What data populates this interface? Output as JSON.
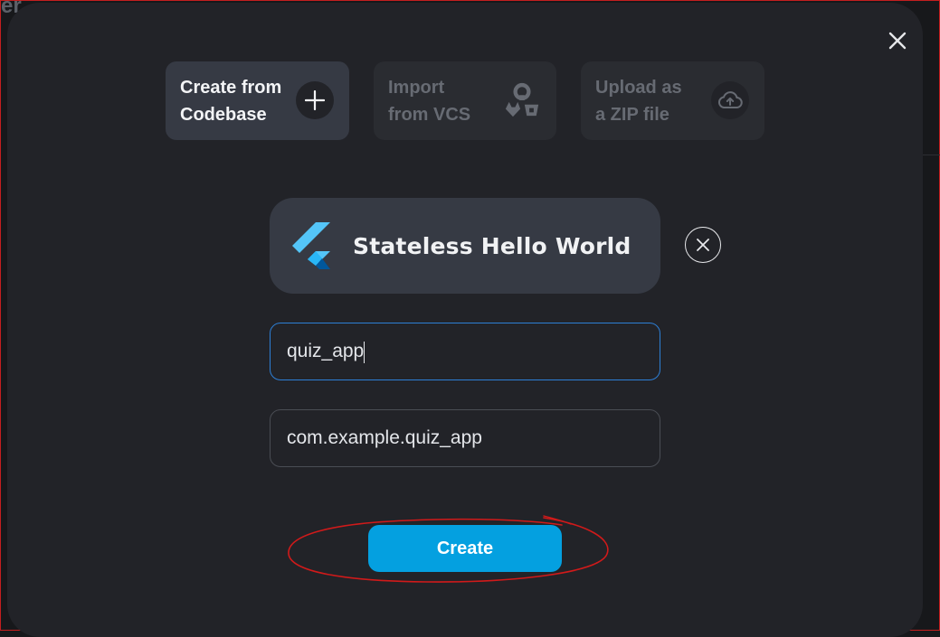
{
  "backdrop": {
    "corner_text": "er"
  },
  "dialog": {
    "tabs": [
      {
        "label": "Create from\nCodebase",
        "icon": "plus-icon",
        "active": true
      },
      {
        "label": "Import\nfrom VCS",
        "icon": "vcs-icon",
        "active": false
      },
      {
        "label": "Upload as\na ZIP file",
        "icon": "cloud-upload-icon",
        "active": false
      }
    ],
    "template": {
      "title": "Stateless Hello World",
      "icon": "flutter-logo-icon"
    },
    "fields": {
      "project_name": {
        "value": "quiz_app"
      },
      "package_name": {
        "value": "com.example.quiz_app"
      }
    },
    "create_label": "Create"
  },
  "colors": {
    "accent": "#04a0e0",
    "focus_border": "#2d7fd6",
    "annotation": "#d11a1a"
  }
}
